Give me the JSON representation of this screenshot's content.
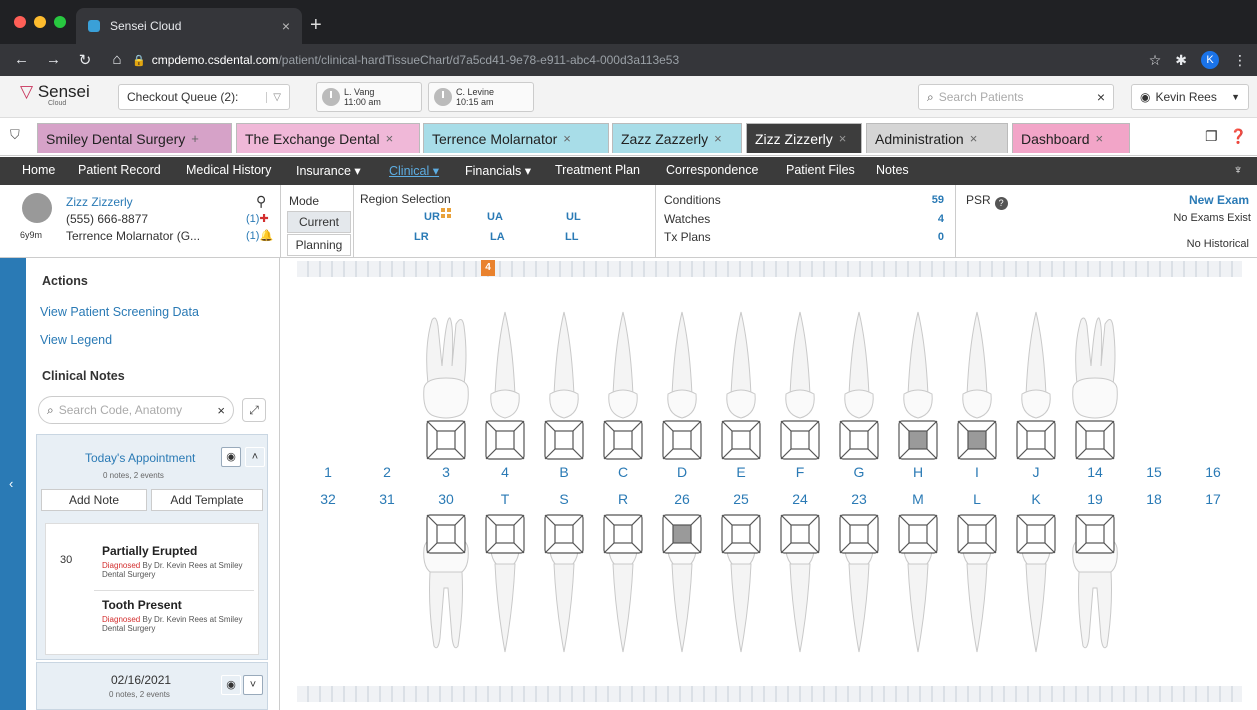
{
  "browser": {
    "tab_title": "Sensei Cloud",
    "tab_close": "×",
    "new_tab": "+",
    "url_host": "cmpdemo.csdental.com",
    "url_path": "/patient/clinical-hardTissueChart/d7a5cd41-9e78-e911-abc4-000d3a113e53",
    "avatar_letter": "K"
  },
  "app": {
    "logo": "Sensei",
    "logo_sub": "Cloud",
    "queue_label": "Checkout Queue (2):",
    "appointments": [
      {
        "name": "L. Vang",
        "time": "11:00 am"
      },
      {
        "name": "C. Levine",
        "time": "10:15 am"
      }
    ],
    "search_placeholder": "Search Patients",
    "search_clear": "×",
    "user_name": "Kevin Rees"
  },
  "tabs": [
    {
      "label": "Smiley Dental Surgery",
      "close": "+",
      "color": "#d6a2c8"
    },
    {
      "label": "The Exchange Dental",
      "close": "×",
      "color": "#f0b8d8"
    },
    {
      "label": "Terrence Molarnator",
      "close": "×",
      "color": "#a8dde8"
    },
    {
      "label": "Zazz Zazzerly",
      "close": "×",
      "color": "#a8dde8"
    },
    {
      "label": "Zizz Zizzerly",
      "close": "×",
      "color": "#3d3d3d"
    },
    {
      "label": "Administration",
      "close": "×",
      "color": "#d5d5d5"
    },
    {
      "label": "Dashboard",
      "close": "×",
      "color": "#f2a5c8"
    }
  ],
  "menu": [
    {
      "label": "Home"
    },
    {
      "label": "Patient Record"
    },
    {
      "label": "Medical History"
    },
    {
      "label": "Insurance ▾"
    },
    {
      "label": "Clinical ▾",
      "active": true
    },
    {
      "label": "Financials ▾"
    },
    {
      "label": "Treatment Plan"
    },
    {
      "label": "Correspondence"
    },
    {
      "label": "Patient Files"
    },
    {
      "label": "Notes"
    }
  ],
  "patient": {
    "name": "Zizz Zizzerly",
    "phone": "(555) 666-8877",
    "age": "6y9m",
    "responsible": "Terrence Molarnator (G...",
    "alert_1": "(1)",
    "alert_2": "(1)"
  },
  "mode": {
    "label": "Mode",
    "current": "Current",
    "planning": "Planning"
  },
  "region": {
    "label": "Region Selection",
    "ur": "UR",
    "ua": "UA",
    "ul": "UL",
    "lr": "LR",
    "la": "LA",
    "ll": "LL"
  },
  "stats": {
    "conditions_label": "Conditions",
    "conditions": "59",
    "watches_label": "Watches",
    "watches": "4",
    "txplans_label": "Tx Plans",
    "txplans": "0"
  },
  "exam": {
    "psr": "PSR",
    "new_exam": "New Exam",
    "no_exams": "No Exams Exist",
    "no_historical": "No Historical"
  },
  "sidebar": {
    "actions": "Actions",
    "screening": "View Patient Screening Data",
    "legend": "View Legend",
    "clinical_notes": "Clinical Notes",
    "search_placeholder": "Search Code, Anatomy",
    "todays_appt": "Today's Appointment",
    "todays_sub": "0 notes,  2 events",
    "add_note": "Add Note",
    "add_template": "Add Template",
    "note_tooth": "30",
    "notes": [
      {
        "title": "Partially Erupted",
        "status": "Diagnosed",
        "by": "By Dr. Kevin Rees at Smiley Dental Surgery"
      },
      {
        "title": "Tooth Present",
        "status": "Diagnosed",
        "by": "By Dr. Kevin Rees at Smiley Dental Surgery"
      }
    ],
    "date": "02/16/2021",
    "date_sub": "0 notes,  2 events"
  },
  "chart": {
    "marker": "4",
    "upper_numbers": [
      "1",
      "2",
      "3",
      "4",
      "B",
      "C",
      "D",
      "E",
      "F",
      "G",
      "H",
      "I",
      "J",
      "14",
      "15",
      "16"
    ],
    "lower_numbers": [
      "32",
      "31",
      "30",
      "T",
      "S",
      "R",
      "26",
      "25",
      "24",
      "23",
      "M",
      "L",
      "K",
      "19",
      "18",
      "17"
    ],
    "upper_surface_fill": [
      false,
      false,
      false,
      false,
      false,
      false,
      false,
      false,
      false,
      false,
      true,
      true,
      false,
      false,
      false,
      false
    ],
    "lower_surface_fill": [
      false,
      false,
      false,
      false,
      false,
      false,
      true,
      false,
      false,
      false,
      false,
      false,
      false,
      false,
      false,
      false
    ]
  }
}
